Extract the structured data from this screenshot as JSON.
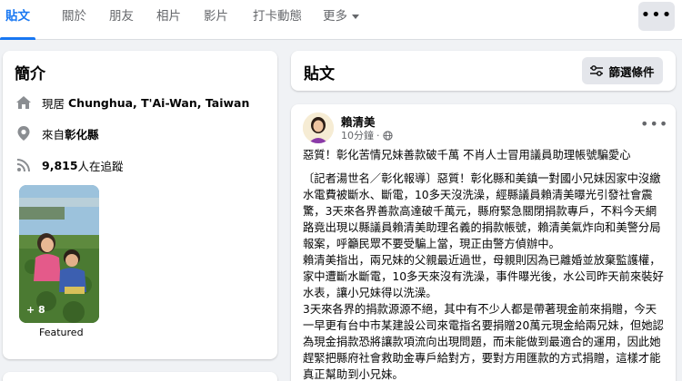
{
  "tabs": [
    {
      "label": "貼文"
    },
    {
      "label": "關於"
    },
    {
      "label": "朋友"
    },
    {
      "label": "相片"
    },
    {
      "label": "影片"
    },
    {
      "label": "打卡動態"
    },
    {
      "label": "更多"
    }
  ],
  "more_menu_icon": "more-dots-icon",
  "intro": {
    "title": "簡介",
    "lives_prefix": "現居 ",
    "lives_place": "Chunghua, T'Ai-Wan, Taiwan",
    "from_prefix": "來自",
    "from_place": "彰化縣",
    "followers_count": "9,815",
    "followers_suffix": " 人在追蹤",
    "featured_count": "+ 8",
    "featured_label": "Featured"
  },
  "posts": {
    "title": "貼文",
    "filter_label": "篩選條件"
  },
  "post": {
    "author": "賴清美",
    "time": "10分鐘",
    "headline": "惡質！彰化苦情兄妹善款破千萬 不肖人士冒用議員助理帳號騙愛心",
    "paragraph1": "〔記者湯世名／彰化報導〕惡質！彰化縣和美鎮一對國小兄妹因家中沒繳水電費被斷水、斷電，10多天沒洗澡，經縣議員賴清美曝光引發社會震驚，3天來各界善款高達破千萬元，縣府緊急關閉捐款專戶，不料今天網路竟出現以縣議員賴清美助理名義的捐款帳號，賴清美氣炸向和美警分局報案，呼籲民眾不要受騙上當，現正由警方偵辦中。",
    "paragraph2": "賴清美指出，兩兄妹的父親最近過世，母親則因為已離婚並放棄監護權，家中遭斷水斷電，10多天來沒有洗澡，事件曝光後，水公司昨天前來裝好水表，讓小兄妹得以洗澡。",
    "paragraph3": "3天來各界的捐款源源不絕，其中有不少人都是帶著現金前來捐贈，今天一早更有台中市某建設公司來電指名要捐贈20萬元現金給兩兄妹，但她認為現金捐款恐將讓款項流向出現問題，而未能做到最適合的運用，因此她趕緊把縣府社會救助金專戶給對方，要對方用匯款的方式捐贈，這樣才能真正幫助到小兄妹。"
  },
  "colors": {
    "accent": "#1877f2",
    "background": "#f0f2f5",
    "secondary_text": "#65676b"
  }
}
